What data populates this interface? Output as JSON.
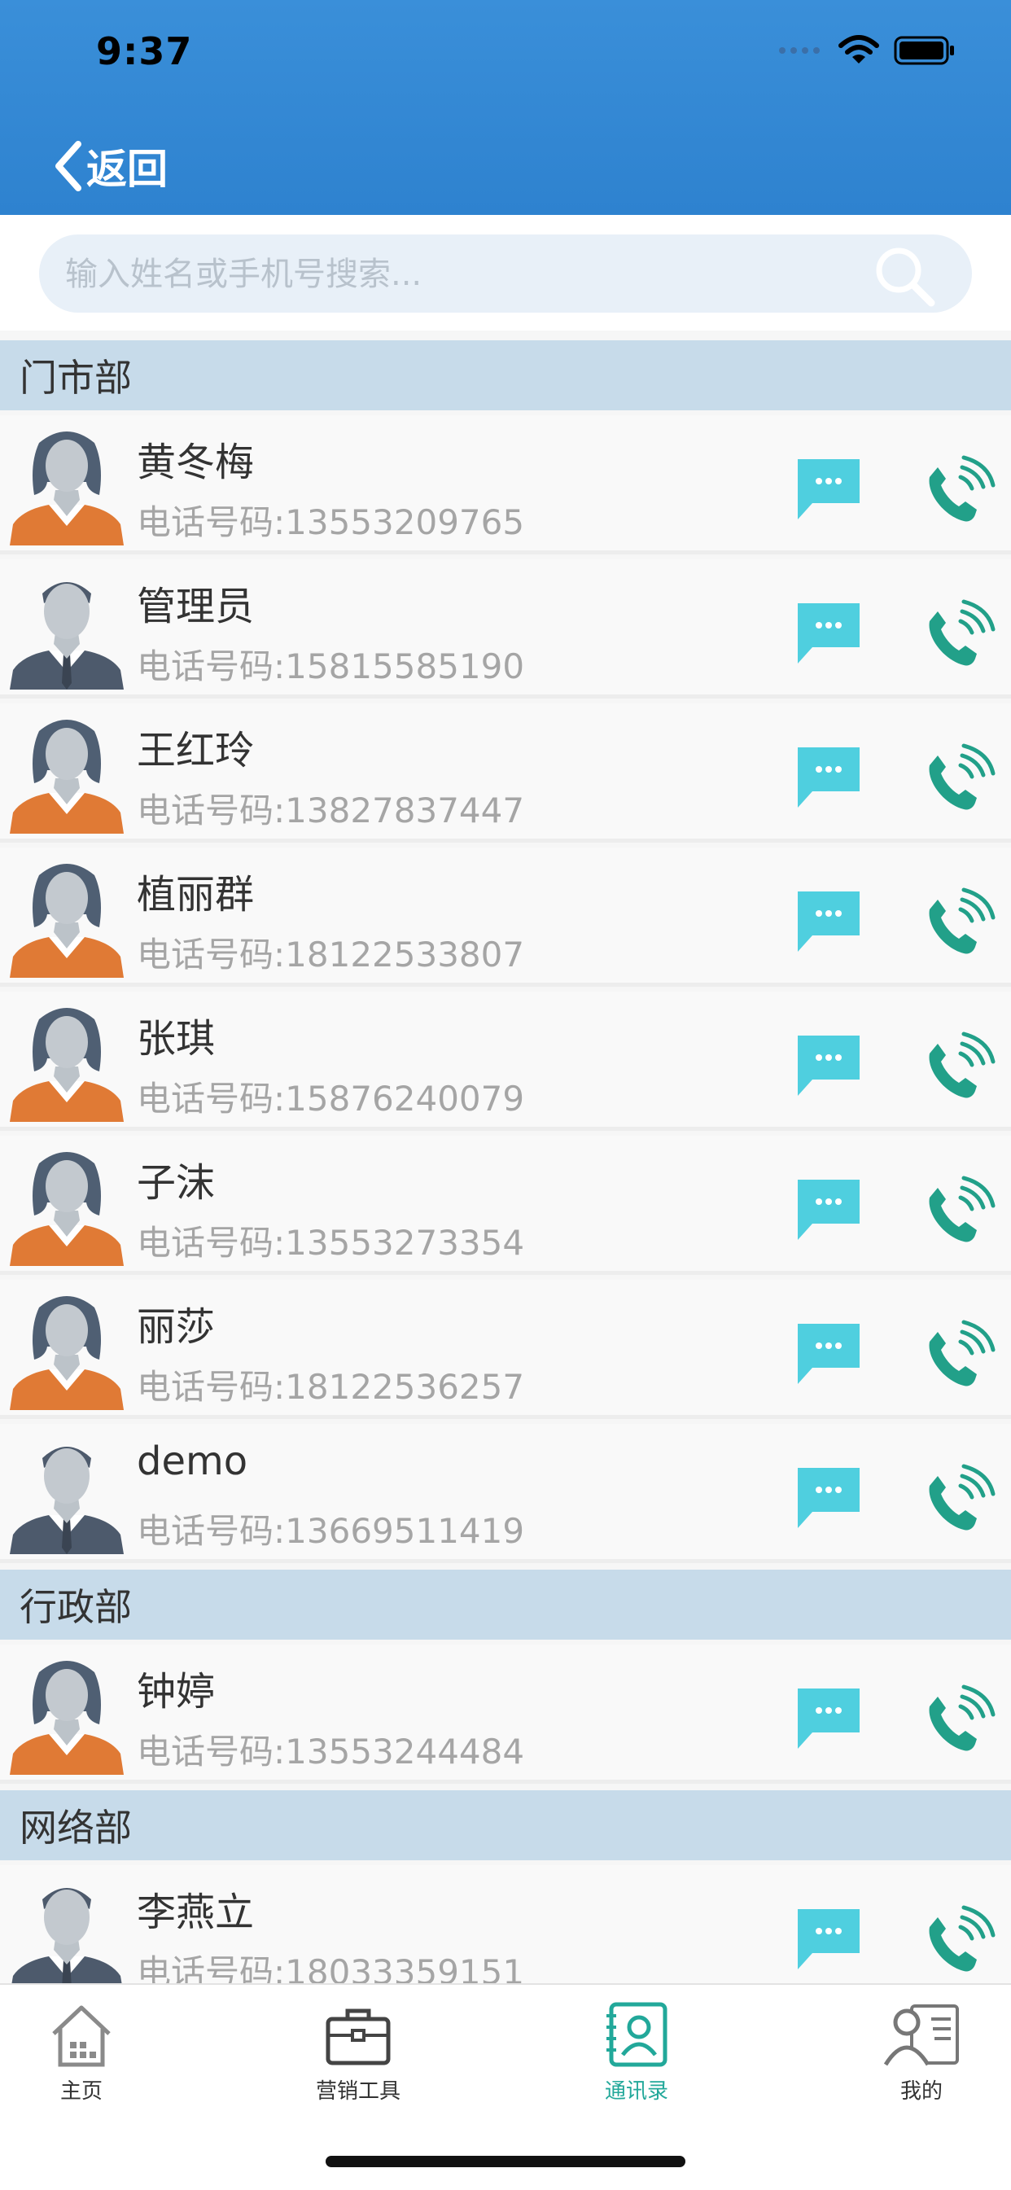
{
  "status": {
    "time": "9:37"
  },
  "nav": {
    "back_label": "返回"
  },
  "search": {
    "placeholder": "输入姓名或手机号搜索..."
  },
  "sections": [
    {
      "title": "门市部",
      "contacts": [
        {
          "name": "黄冬梅",
          "phone": "电话号码:13553209765",
          "avatar": "female-avatar"
        },
        {
          "name": "管理员",
          "phone": "电话号码:15815585190",
          "avatar": "male-avatar"
        },
        {
          "name": "王红玲",
          "phone": "电话号码:13827837447",
          "avatar": "female-avatar"
        },
        {
          "name": "植丽群",
          "phone": "电话号码:18122533807",
          "avatar": "female-avatar"
        },
        {
          "name": "张琪",
          "phone": "电话号码:15876240079",
          "avatar": "female-avatar"
        },
        {
          "name": "子沫",
          "phone": "电话号码:13553273354",
          "avatar": "female-avatar"
        },
        {
          "name": "丽莎",
          "phone": "电话号码:18122536257",
          "avatar": "female-avatar"
        },
        {
          "name": "demo",
          "phone": "电话号码:13669511419",
          "avatar": "male-avatar"
        }
      ]
    },
    {
      "title": "行政部",
      "contacts": [
        {
          "name": "钟婷",
          "phone": "电话号码:13553244484",
          "avatar": "female-avatar"
        }
      ]
    },
    {
      "title": "网络部",
      "contacts": [
        {
          "name": "李燕立",
          "phone": "电话号码:18033359151",
          "avatar": "male-avatar"
        }
      ]
    }
  ],
  "tabbar": {
    "items": [
      {
        "label": "主页",
        "icon": "home-icon"
      },
      {
        "label": "营销工具",
        "icon": "briefcase-icon"
      },
      {
        "label": "通讯录",
        "icon": "contacts-icon"
      },
      {
        "label": "我的",
        "icon": "profile-icon"
      }
    ],
    "active_index": 2
  },
  "colors": {
    "header": "#2e82cf",
    "section_header_bg": "#c7dbea",
    "message_icon": "#4fcfdf",
    "call_icon": "#22a089",
    "tab_active": "#22a89a"
  }
}
